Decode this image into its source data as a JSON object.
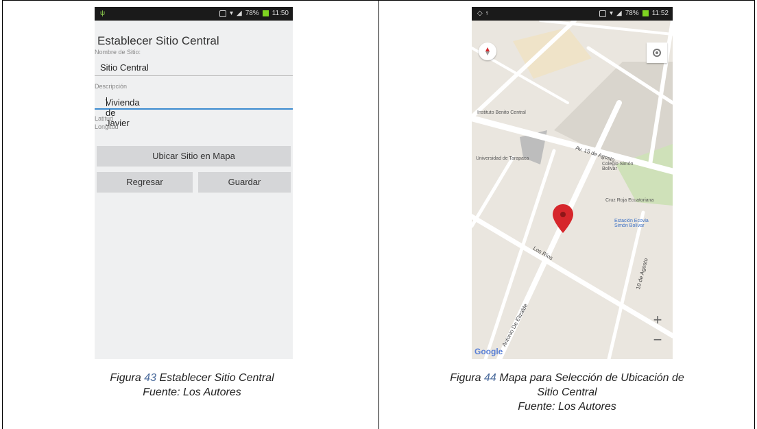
{
  "left_panel": {
    "status_time": "11:50",
    "battery": "78%",
    "form_title": "Establecer Sitio Central",
    "site_name_label": "Nombre de Sitio:",
    "site_name_value": "Sitio Central",
    "description_label": "Descripción",
    "description_value": "Vivienda de Javier",
    "latitude_label": "Latitud",
    "longitude_label": "Longitud",
    "locate_button": "Ubicar Sitio en Mapa",
    "back_button": "Regresar",
    "save_button": "Guardar",
    "caption_prefix": "Figura",
    "caption_number": "43",
    "caption_title": "Establecer Sitio Central",
    "caption_source": "Fuente: Los Autores"
  },
  "right_panel": {
    "status_time": "11:52",
    "battery": "78%",
    "map_labels": {
      "ibm": "Instituto Benito Central",
      "uni": "Universidad de Tarapaca",
      "av15": "Av. 15 de Agosto",
      "colegio": "Colegio Simón Bolívar",
      "cruz": "Cruz Roja Ecuatoriana",
      "estacion": "Estación Ecovia Simón Bolívar",
      "losrios": "Los Ríos",
      "elizalde": "Antonio De Elizalde",
      "agosto": "10 de Agosto",
      "google": "Google"
    },
    "zoom_in": "+",
    "zoom_out": "−",
    "caption_prefix": "Figura",
    "caption_number": "44",
    "caption_title_line1": "Mapa para Selección de Ubicación de",
    "caption_title_line2": "Sitio Central",
    "caption_source": "Fuente: Los Autores"
  },
  "colors": {
    "accent_blue": "#3b8bd0",
    "map_pin": "#d6262b",
    "figure_number": "#4b6b9c"
  }
}
